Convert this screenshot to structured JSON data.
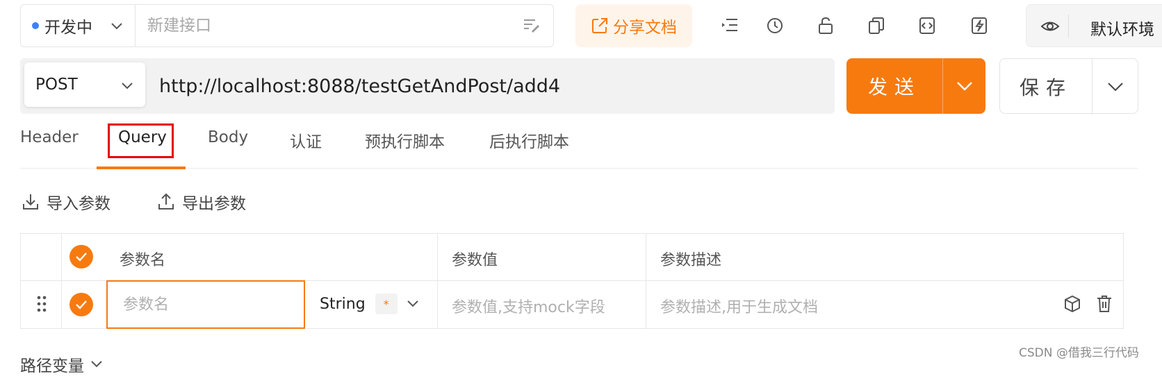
{
  "top_bar": {
    "status_label": "开发中",
    "name_placeholder": "新建接口",
    "share_label": "分享文档",
    "env_label": "默认环境"
  },
  "request": {
    "method": "POST",
    "url": "http://localhost:8088/testGetAndPost/add4",
    "send_label": "发送",
    "save_label": "保存"
  },
  "tabs": [
    "Header",
    "Query",
    "Body",
    "认证",
    "预执行脚本",
    "后执行脚本"
  ],
  "active_tab": "Query",
  "params_toolbar": {
    "import_label": "导入参数",
    "export_label": "导出参数"
  },
  "params_table": {
    "headers": [
      "参数名",
      "参数值",
      "参数描述"
    ],
    "row": {
      "name_placeholder": "参数名",
      "type": "String",
      "required_mark": "*",
      "value_placeholder": "参数值,支持mock字段",
      "desc_placeholder": "参数描述,用于生成文档"
    }
  },
  "path_vars_label": "路径变量",
  "watermark": "CSDN @借我三行代码",
  "colors": {
    "accent": "#f77a0f",
    "status_dot": "#3b82f6",
    "highlight_box": "#e60000"
  }
}
